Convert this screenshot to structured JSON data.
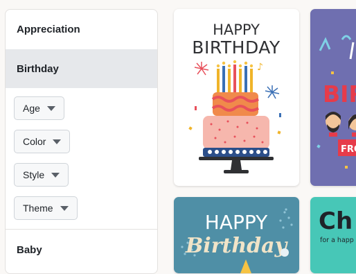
{
  "sidebar": {
    "categories": {
      "appreciation": "Appreciation",
      "birthday": "Birthday",
      "baby": "Baby"
    },
    "filters": [
      "Age",
      "Color",
      "Style",
      "Theme"
    ]
  },
  "cards": {
    "card1": {
      "line1": "HAPPY",
      "line2": "BIRTHDAY"
    },
    "card2": {
      "text1": "BIR",
      "text2": "FRO"
    },
    "card3": {
      "line1": "HAPPY",
      "line2": "Birthday"
    },
    "card4": {
      "title": "Ch",
      "subtitle": "for a happ"
    }
  },
  "colors": {
    "selected_bg": "#e6e8eb",
    "card2_bg": "#6f6fb0",
    "card3_bg": "#4f8fa6",
    "card4_bg": "#47c7b7"
  }
}
